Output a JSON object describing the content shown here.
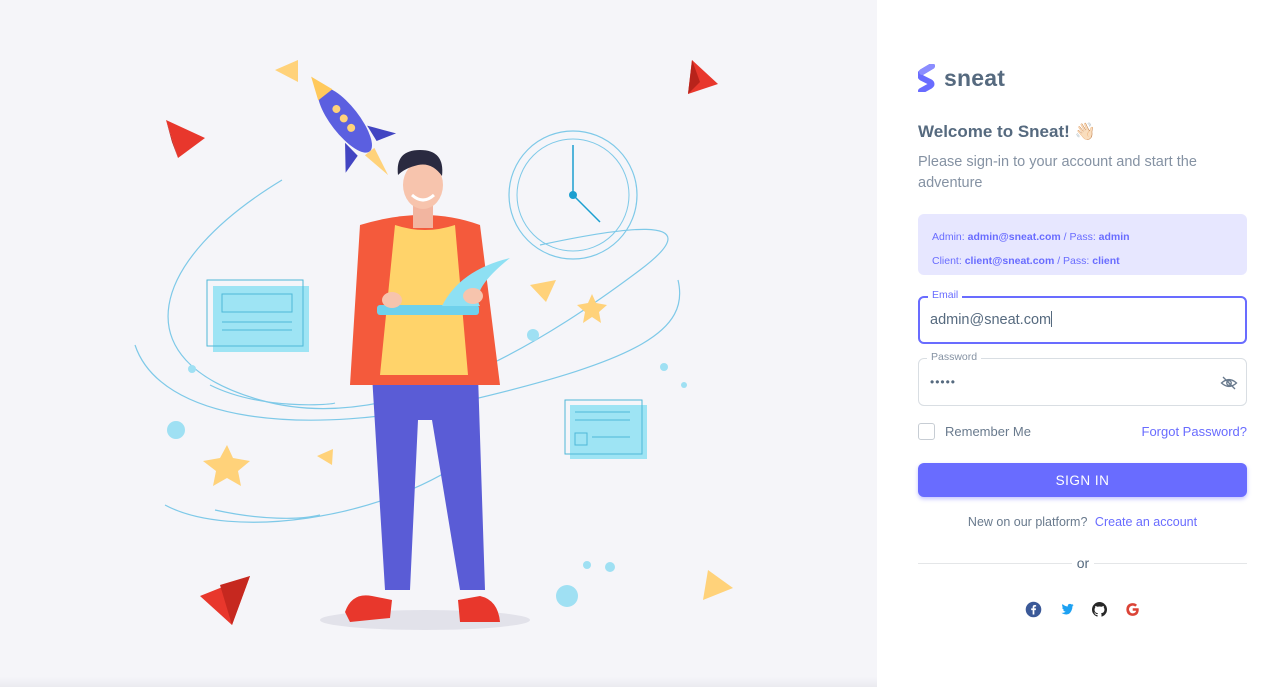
{
  "brand": {
    "name": "sneat",
    "color": "#696cff"
  },
  "welcome": {
    "title": "Welcome to Sneat! 👋🏻",
    "subtitle": "Please sign-in to your account and start the adventure"
  },
  "credentials_alert": {
    "admin_prefix": "Admin: ",
    "admin_email": "admin@sneat.com",
    "admin_sep": " / Pass: ",
    "admin_pass": "admin",
    "client_prefix": "Client: ",
    "client_email": "client@sneat.com",
    "client_sep": " / Pass: ",
    "client_pass": "client"
  },
  "form": {
    "email_label": "Email",
    "email_value": "admin@sneat.com",
    "password_label": "Password",
    "password_value": "•••••",
    "remember_label": "Remember Me",
    "remember_checked": false,
    "forgot_label": "Forgot Password?",
    "signin_label": "SIGN IN"
  },
  "signup": {
    "prompt": "New on our platform?",
    "link": "Create an account"
  },
  "divider": {
    "label": "or"
  },
  "social": [
    {
      "name": "facebook-icon",
      "color": "#3b5998"
    },
    {
      "name": "twitter-icon",
      "color": "#1da1f2"
    },
    {
      "name": "github-icon",
      "color": "#272727"
    },
    {
      "name": "google-icon",
      "color": "#db4437"
    }
  ],
  "colors": {
    "primary": "#696cff",
    "text": "#566a7f",
    "muted": "#8592a3"
  }
}
